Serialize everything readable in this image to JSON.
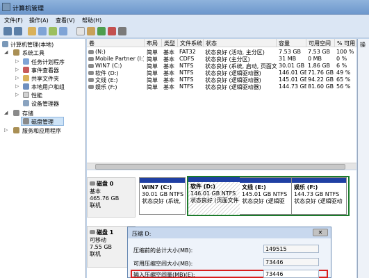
{
  "window": {
    "title": "计算机管理"
  },
  "menu": [
    "文件(F)",
    "操作(A)",
    "查看(V)",
    "帮助(H)"
  ],
  "tree": {
    "root": "计算机管理(本地)",
    "system_tools": "系统工具",
    "items": [
      "任务计划程序",
      "事件查看器",
      "共享文件夹",
      "本地用户和组",
      "性能",
      "设备管理器"
    ],
    "storage": "存储",
    "disk_mgmt": "磁盘管理",
    "services": "服务和应用程序"
  },
  "volumes": {
    "headers": [
      "卷",
      "布局",
      "类型",
      "文件系统",
      "状态",
      "容量",
      "可用空间",
      "% 可用"
    ],
    "rows": [
      [
        "(N:)",
        "简单",
        "基本",
        "FAT32",
        "状态良好 (活动, 主分区)",
        "7.53 GB",
        "7.53 GB",
        "100 %"
      ],
      [
        "Mobile Partner (I:)",
        "简单",
        "基本",
        "CDFS",
        "状态良好 (主分区)",
        "31 MB",
        "0 MB",
        "0 %"
      ],
      [
        "WIN7 (C:)",
        "简单",
        "基本",
        "NTFS",
        "状态良好 (系统, 启动, 页面文件, 活动, 故障转储, 主分区)",
        "30.01 GB",
        "1.86 GB",
        "6 %"
      ],
      [
        "软件 (D:)",
        "简单",
        "基本",
        "NTFS",
        "状态良好 (逻辑驱动器)",
        "146.01 GB",
        "71.76 GB",
        "49 %"
      ],
      [
        "文线 (E:)",
        "简单",
        "基本",
        "NTFS",
        "状态良好 (逻辑驱动器)",
        "145.01 GB",
        "94.22 GB",
        "65 %"
      ],
      [
        "娱乐 (F:)",
        "简单",
        "基本",
        "NTFS",
        "状态良好 (逻辑驱动器)",
        "144.73 GB",
        "81.60 GB",
        "56 %"
      ]
    ]
  },
  "right_label": "操",
  "disk0": {
    "name": "磁盘 0",
    "type": "基本",
    "size": "465.76 GB",
    "status": "联机",
    "partitions": [
      {
        "name": "WIN7  (C:)",
        "size": "30.01 GB NTFS",
        "status": "状态良好 (系统,"
      },
      {
        "name": "软件  (D:)",
        "size": "146.01 GB NTFS",
        "status": "状态良好 (页面文件"
      },
      {
        "name": "文线  (E:)",
        "size": "145.01 GB NTFS",
        "status": "状态良好 (逻辑驱"
      },
      {
        "name": "娱乐  (F:)",
        "size": "144.73 GB NTFS",
        "status": "状态良好 (逻辑驱动"
      }
    ]
  },
  "disk1": {
    "name": "磁盘 1",
    "type": "可移动",
    "size": "7.55 GB",
    "status": "联机"
  },
  "dialog": {
    "title": "压缩 D:",
    "rows": [
      {
        "label": "压缩前的总计大小(MB):",
        "value": "149515"
      },
      {
        "label": "可用压缩空间大小(MB):",
        "value": "73446"
      },
      {
        "label": "输入压缩空间量(MB)(E):",
        "value": "73446"
      }
    ]
  },
  "colors": {
    "accent": "#1f3fa3",
    "selection": "#1c7c2c",
    "highlight": "#d81e1e"
  }
}
